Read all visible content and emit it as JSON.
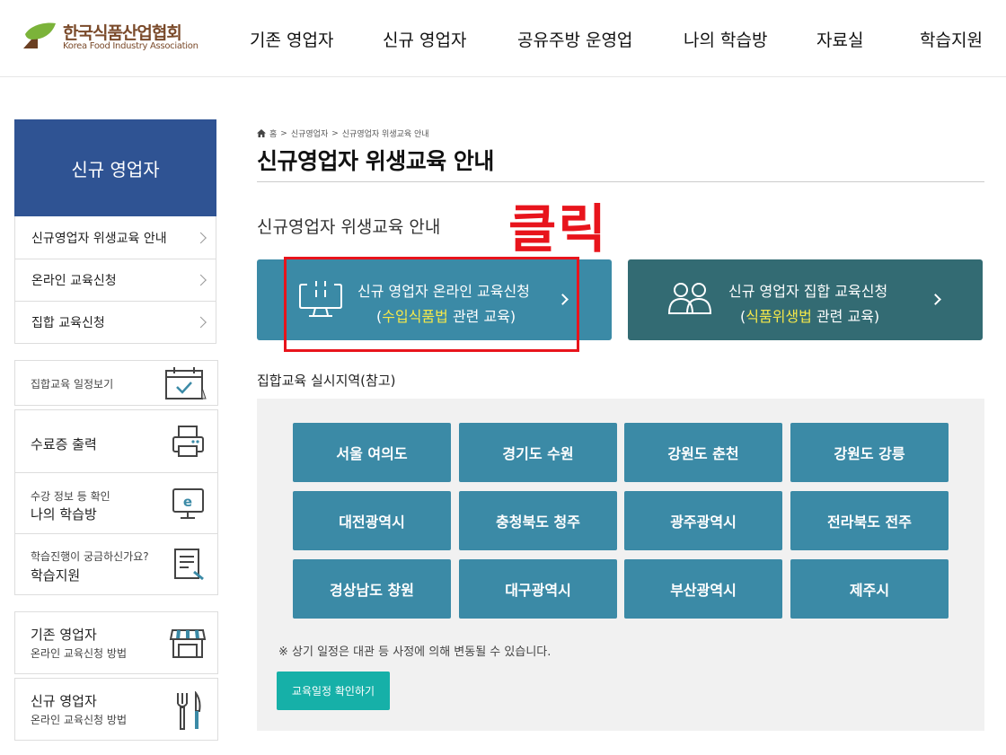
{
  "header": {
    "logo_ko": "한국식품산업협회",
    "logo_en": "Korea Food Industry Association",
    "nav": [
      "기존 영업자",
      "신규 영업자",
      "공유주방 운영업",
      "나의 학습방",
      "자료실",
      "학습지원"
    ]
  },
  "sidebar": {
    "title": "신규 영업자",
    "menu": [
      "신규영업자 위생교육 안내",
      "온라인 교육신청",
      "집합 교육신청"
    ],
    "quick": {
      "schedule": "집합교육 일정보기",
      "certificate": "수료증 출력",
      "mylearn_sub": "수강 정보 등 확인",
      "mylearn_main": "나의 학습방",
      "support_sub": "학습진행이 궁금하신가요?",
      "support_main": "학습지원"
    },
    "guides": [
      {
        "main": "기존 영업자",
        "sub": "온라인 교육신청 방법"
      },
      {
        "main": "신규 영업자",
        "sub": "온라인 교육신청 방법"
      }
    ]
  },
  "breadcrumb": {
    "home": "홈",
    "level1": "신규영업자",
    "level2": "신규영업자 위생교육 안내"
  },
  "page": {
    "title": "신규영업자 위생교육 안내",
    "section_title": "신규영업자 위생교육 안내",
    "annotation": "클릭"
  },
  "cta": {
    "online": {
      "line1": "신규 영업자 온라인 교육신청",
      "open": "(",
      "highlight": "수입식품법",
      "rest": " 관련 교육)"
    },
    "group": {
      "line1": "신규 영업자 집합 교육신청",
      "open": "(",
      "highlight": "식품위생법",
      "rest": " 관련 교육)"
    }
  },
  "regions": {
    "title": "집합교육 실시지역(참고)",
    "items": [
      "서울 여의도",
      "경기도 수원",
      "강원도 춘천",
      "강원도 강릉",
      "대전광역시",
      "충청북도 청주",
      "광주광역시",
      "전라북도 전주",
      "경상남도 창원",
      "대구광역시",
      "부산광역시",
      "제주시"
    ],
    "notice": "※ 상기 일정은 대관 등 사정에 의해 변동될 수 있습니다.",
    "button": "교육일정 확인하기"
  },
  "colors": {
    "brand_blue": "#2f5393",
    "cta_online": "#3b8aa6",
    "cta_group": "#336b73",
    "region_btn": "#3b8aa6",
    "teal_btn": "#16b0a8",
    "annotation_red": "#e8141c"
  }
}
